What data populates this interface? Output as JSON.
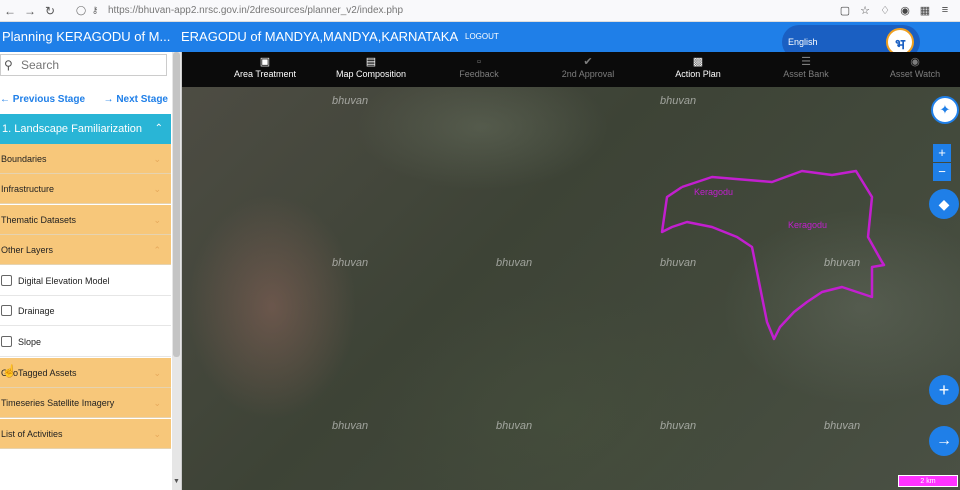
{
  "browser": {
    "url": "https://bhuvan-app2.nrsc.gov.in/2dresources/planner_v2/index.php"
  },
  "header": {
    "title": "Planning KERAGODU of M...",
    "subtitle": "ERAGODU of MANDYA,MANDYA,KARNATAKA",
    "logout_label": "LOGOUT",
    "language_label": "English",
    "logo_glyph": "भ"
  },
  "toolbar": {
    "items": [
      {
        "label": "Area Treatment",
        "icon": "plus-box-icon"
      },
      {
        "label": "Map Composition",
        "icon": "map-icon"
      },
      {
        "label": "Feedback",
        "icon": "chat-icon"
      },
      {
        "label": "2nd Approval",
        "icon": "check-circle-icon"
      },
      {
        "label": "Action Plan",
        "icon": "save-icon"
      },
      {
        "label": "Asset Bank",
        "icon": "asset-bank-icon"
      },
      {
        "label": "Asset Watch",
        "icon": "eye-icon"
      }
    ]
  },
  "sidebar": {
    "search_placeholder": "Search",
    "prev_stage": "Previous Stage",
    "next_stage": "Next Stage",
    "section_title": "1. Landscape Familiarization",
    "layers_top": [
      "Boundaries",
      "Infrastructure",
      "Thematic Datasets",
      "Other Layers"
    ],
    "sub_layers": [
      "Digital Elevation Model",
      "Drainage",
      "Slope"
    ],
    "layers_bottom": [
      "GeoTagged Assets",
      "Timeseries Satellite Imagery",
      "List of Activities"
    ]
  },
  "map": {
    "watermark": "bhuvan",
    "scale_label": "2 km",
    "boundary_labels": [
      "Keragodu",
      "Keragodu"
    ],
    "colors": {
      "boundary": "#c21fcf",
      "accent": "#1f7fe8"
    }
  }
}
